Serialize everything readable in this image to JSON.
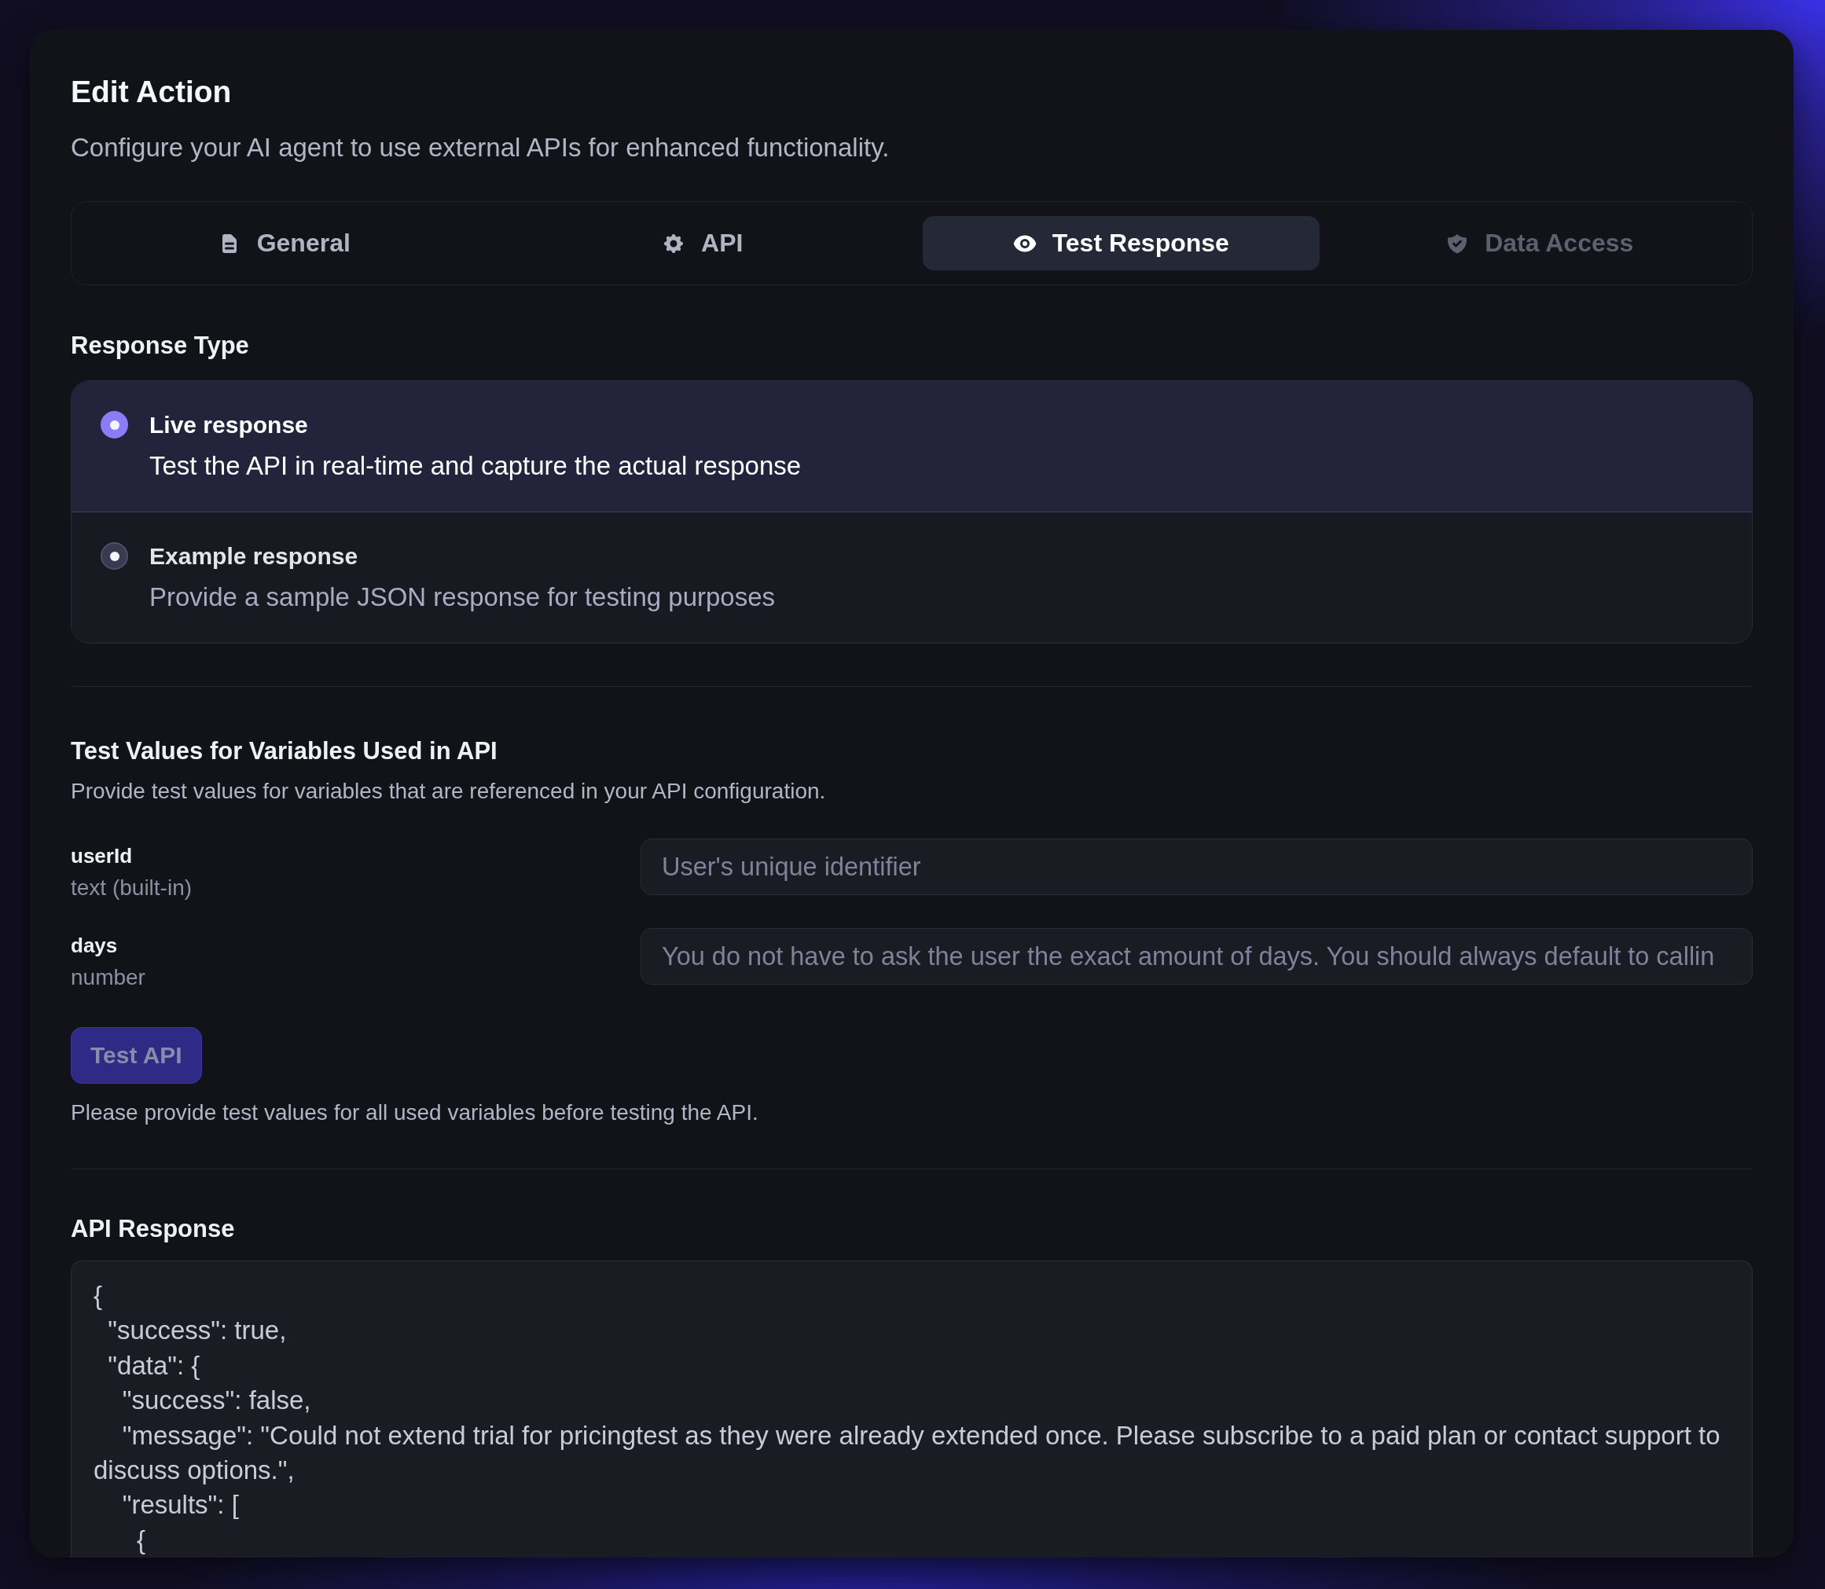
{
  "dialog": {
    "title": "Edit Action",
    "subtitle": "Configure your AI agent to use external APIs for enhanced functionality."
  },
  "tabs": [
    {
      "label": "General",
      "selected": false,
      "disabled": false
    },
    {
      "label": "API",
      "selected": false,
      "disabled": false
    },
    {
      "label": "Test Response",
      "selected": true,
      "disabled": false
    },
    {
      "label": "Data Access",
      "selected": false,
      "disabled": true
    }
  ],
  "response_type": {
    "label": "Response Type",
    "options": [
      {
        "title": "Live response",
        "description": "Test the API in real-time and capture the actual response",
        "selected": true
      },
      {
        "title": "Example response",
        "description": "Provide a sample JSON response for testing purposes",
        "selected": false
      }
    ]
  },
  "test_values": {
    "title": "Test Values for Variables Used in API",
    "description": "Provide test values for variables that are referenced in your API configuration.",
    "variables": [
      {
        "name": "userId",
        "type": "text (built-in)",
        "placeholder": "User's unique identifier"
      },
      {
        "name": "days",
        "type": "number",
        "placeholder": "You do not have to ask the user the exact amount of days. You should always default to callin"
      }
    ],
    "button": {
      "label": "Test API",
      "disabled": true
    },
    "hint": "Please provide test values for all used variables before testing the API."
  },
  "api_response": {
    "title": "API Response",
    "lines": [
      "{",
      "  \"success\": true,",
      "  \"data\": {",
      "    \"success\": false,",
      "    \"message\": \"Could not extend trial for pricingtest as they were already extended once. Please subscribe to a paid plan or contact support to discuss options.\",",
      "    \"results\": [",
      "      {"
    ]
  }
}
